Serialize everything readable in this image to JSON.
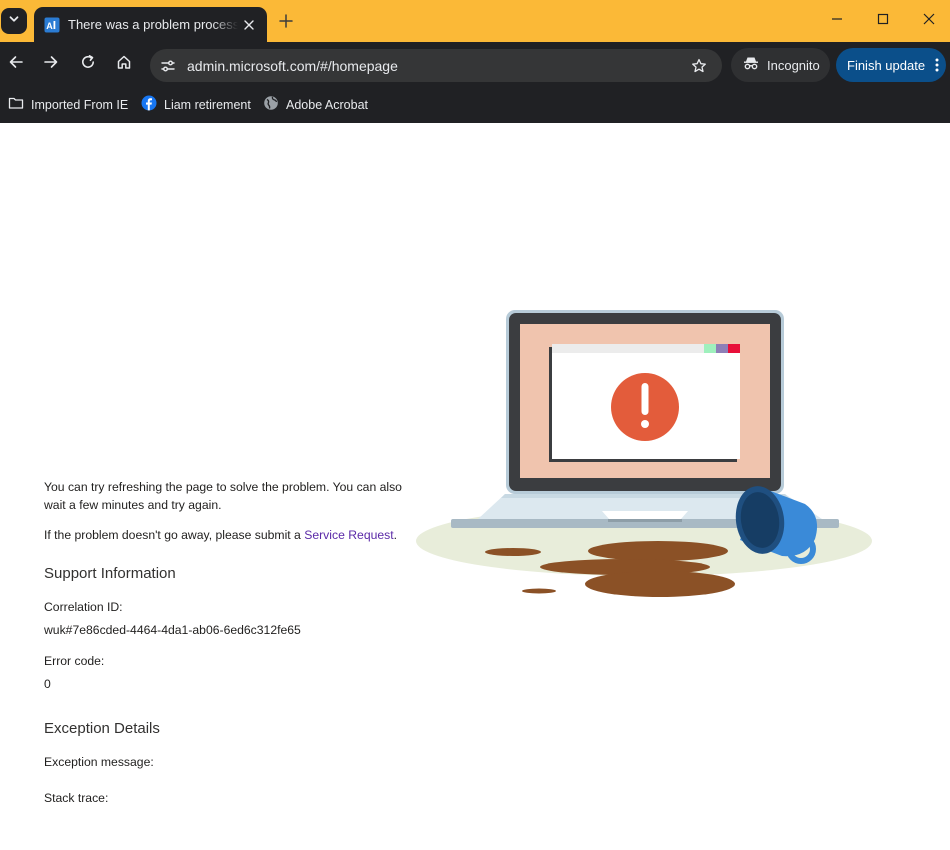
{
  "browser": {
    "tab": {
      "title": "There was a problem processing your request"
    },
    "address_bar": {
      "url": "admin.microsoft.com/#/homepage"
    },
    "incognito_label": "Incognito",
    "finish_update_label": "Finish update",
    "bookmarks": [
      {
        "label": "Imported From IE",
        "icon": "folder-icon"
      },
      {
        "label": "Liam retirement",
        "icon": "facebook-icon"
      },
      {
        "label": "Adobe Acrobat",
        "icon": "globe-icon"
      }
    ]
  },
  "page": {
    "message_refresh": "You can try refreshing the page to solve the problem. You can also wait a few minutes and try again.",
    "message_persist_prefix": "If the problem doesn't go away, please submit a ",
    "service_request_link": "Service Request",
    "message_persist_suffix": ".",
    "support_heading": "Support Information",
    "correlation_label": "Correlation ID:",
    "correlation_value": "wuk#7e86cded-4464-4da1-ab06-6ed6c312fe65",
    "error_code_label": "Error code:",
    "error_code_value": "0",
    "exception_heading": "Exception Details",
    "exception_message_label": "Exception message:",
    "stack_trace_label": "Stack trace:"
  },
  "colors": {
    "tabstrip": "#fbb937",
    "chrome_dark": "#202124",
    "omnibox": "#353637",
    "finish_update": "#0b4f8a",
    "link": "#5b2aa8",
    "error_circle": "#e35c3b",
    "screen_bg": "#f0c4ae",
    "coffee": "#8b5126",
    "mug": "#3a8ad8"
  }
}
